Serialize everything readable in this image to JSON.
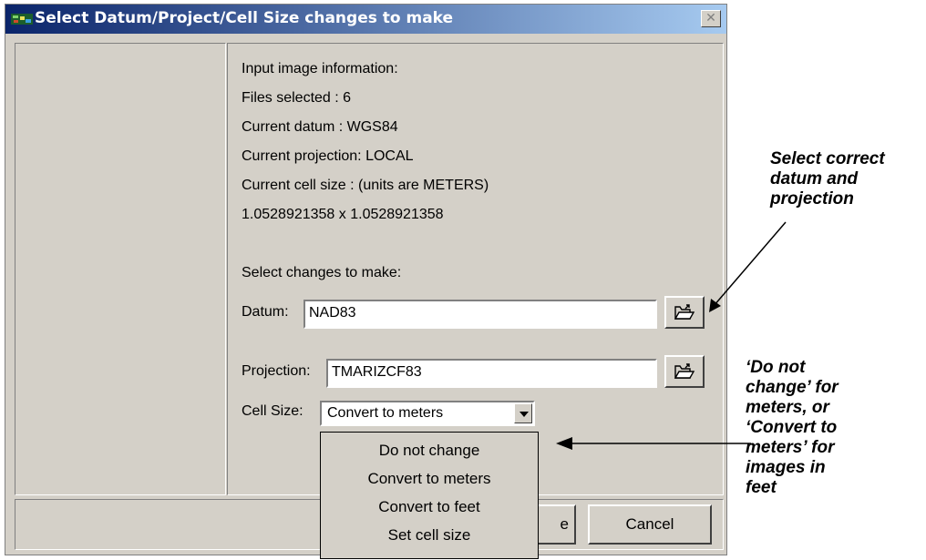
{
  "window": {
    "title": "Select Datum/Project/Cell Size changes to make",
    "close_glyph": "✕"
  },
  "info": {
    "lines": [
      "Input image information:",
      "Files selected   : 6",
      "Current datum    : WGS84",
      "Current projection: LOCAL",
      "Current cell size : (units are METERS)",
      "1.0528921358 x 1.0528921358"
    ],
    "changes_heading": "Select changes to make:"
  },
  "datum": {
    "label": "Datum:",
    "value": "NAD83"
  },
  "projection": {
    "label": "Projection:",
    "value": "TMARIZCF83"
  },
  "cell_size": {
    "label": "Cell Size:",
    "selected": "Convert to meters",
    "options": [
      "Do not change",
      "Convert to meters",
      "Convert to feet",
      "Set cell size"
    ]
  },
  "buttons": {
    "partial_label": "e",
    "cancel": "Cancel"
  },
  "annotations": {
    "note1": [
      "Select correct",
      "datum and",
      "projection"
    ],
    "note2": [
      "‘Do not",
      "change’ for",
      "meters, or",
      "‘Convert to",
      "meters’ for",
      "images in",
      "feet"
    ]
  },
  "icons": {
    "app": "app-icon",
    "folder": "open-folder-icon"
  }
}
